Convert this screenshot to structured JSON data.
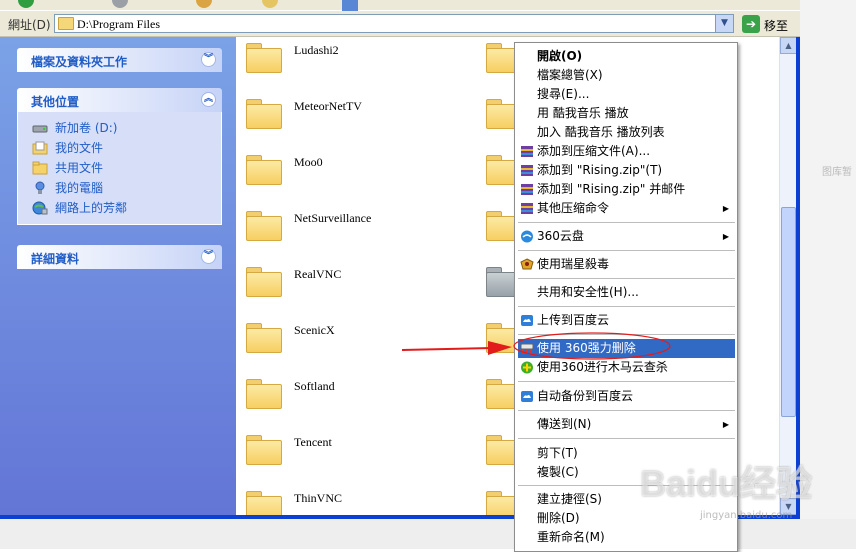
{
  "address_bar": {
    "label": "網址(D)",
    "value": "D:\\Program Files",
    "go_label": "移至"
  },
  "left_pane": {
    "sections": [
      {
        "title": "檔案及資料夾工作",
        "collapsed": true,
        "items": []
      },
      {
        "title": "其他位置",
        "collapsed": false,
        "items": [
          {
            "label": "新加卷 (D:)",
            "icon": "drive-icon"
          },
          {
            "label": "我的文件",
            "icon": "documents-folder-icon"
          },
          {
            "label": "共用文件",
            "icon": "shared-folder-icon"
          },
          {
            "label": "我的電腦",
            "icon": "computer-icon"
          },
          {
            "label": "網路上的芳鄰",
            "icon": "network-icon"
          }
        ]
      },
      {
        "title": "詳細資料",
        "collapsed": true,
        "items": []
      }
    ]
  },
  "files": [
    {
      "name": "Ludashi2",
      "icon": "folder-icon"
    },
    {
      "name": "MeteorNetTV",
      "icon": "folder-icon"
    },
    {
      "name": "Moo0",
      "icon": "folder-icon"
    },
    {
      "name": "NetSurveillance",
      "icon": "folder-icon"
    },
    {
      "name": "RealVNC",
      "icon": "folder-icon"
    },
    {
      "name": "ScenicX",
      "icon": "folder-icon"
    },
    {
      "name": "Softland",
      "icon": "folder-icon"
    },
    {
      "name": "Tencent",
      "icon": "folder-icon"
    },
    {
      "name": "ThinVNC",
      "icon": "folder-icon"
    }
  ],
  "context_menu": {
    "items": [
      {
        "label": "開啟(O)",
        "bold": true
      },
      {
        "label": "檔案總管(X)"
      },
      {
        "label": "搜尋(E)..."
      },
      {
        "label": "用 酷我音乐 播放"
      },
      {
        "label": "加入 酷我音乐 播放列表"
      },
      {
        "label": "添加到压缩文件(A)...",
        "icon": "winrar-icon"
      },
      {
        "label": "添加到 \"Rising.zip\"(T)",
        "icon": "winrar-icon"
      },
      {
        "label": "添加到 \"Rising.zip\" 并邮件",
        "icon": "winrar-icon"
      },
      {
        "label": "其他压缩命令",
        "icon": "winrar-icon",
        "submenu": true
      },
      {
        "label": "360云盘",
        "icon": "cloud-360-icon",
        "submenu": true
      },
      {
        "label": "使用瑞星殺毒",
        "icon": "rising-lion-icon"
      },
      {
        "label": "共用和安全性(H)..."
      },
      {
        "label": "上传到百度云",
        "icon": "baidu-cloud-icon"
      },
      {
        "label": "使用 360强力删除",
        "icon": "shredder-icon",
        "highlighted": true
      },
      {
        "label": "使用360进行木马云查杀",
        "icon": "360-plus-icon"
      },
      {
        "label": "自动备份到百度云",
        "icon": "baidu-cloud-icon"
      },
      {
        "label": "傳送到(N)",
        "submenu": true
      },
      {
        "label": "剪下(T)"
      },
      {
        "label": "複製(C)"
      },
      {
        "label": "建立捷徑(S)"
      },
      {
        "label": "刪除(D)"
      },
      {
        "label": "重新命名(M)"
      }
    ]
  },
  "watermark": {
    "logo": "Baidu经验",
    "url": "jingyan.baidu.com"
  },
  "side_text": "图库暂",
  "colors": {
    "highlight": "#316ac5",
    "link": "#215dc6",
    "pane_gradient_top": "#7ba2e7",
    "arrow": "#e21b1b"
  }
}
